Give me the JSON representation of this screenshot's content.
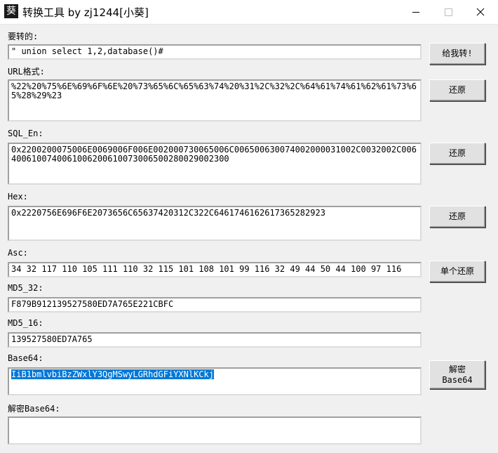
{
  "window": {
    "title": "转换工具 by zj1244[小葵]"
  },
  "labels": {
    "input": "要转的:",
    "url": "URL格式:",
    "sql_en": "SQL_En:",
    "hex": "Hex:",
    "asc": "Asc:",
    "md5_32": "MD5_32:",
    "md5_16": "MD5_16:",
    "base64": "Base64:",
    "decode_base64": "解密Base64:"
  },
  "values": {
    "input": "\" union select 1,2,database()#",
    "url": "%22%20%75%6E%69%6F%6E%20%73%65%6C%65%63%74%20%31%2C%32%2C%64%61%74%61%62%61%73%65%28%29%23",
    "sql_en": "0x2200200075006E0069006F006E002000730065006C006500630074002000031002C0032002C0064006100740061006200610073006500280029002300",
    "hex": "0x2220756E696F6E2073656C65637420312C322C6461746162617365282923",
    "asc": "34 32 117 110 105 111 110 32 115 101 108 101 99 116 32 49 44 50 44 100 97 116",
    "md5_32": "F879B912139527580ED7A765E221CBFC",
    "md5_16": "139527580ED7A765",
    "base64": "IiB1bmlvbiBzZWxlY3QgMSwyLGRhdGFiYXNlKCkj",
    "decode_base64": ""
  },
  "buttons": {
    "convert": "给我转!",
    "restore_url": "还原",
    "restore_sql": "还原",
    "restore_hex": "还原",
    "restore_single": "单个还原",
    "decode_base64": "解密\nBase64"
  }
}
